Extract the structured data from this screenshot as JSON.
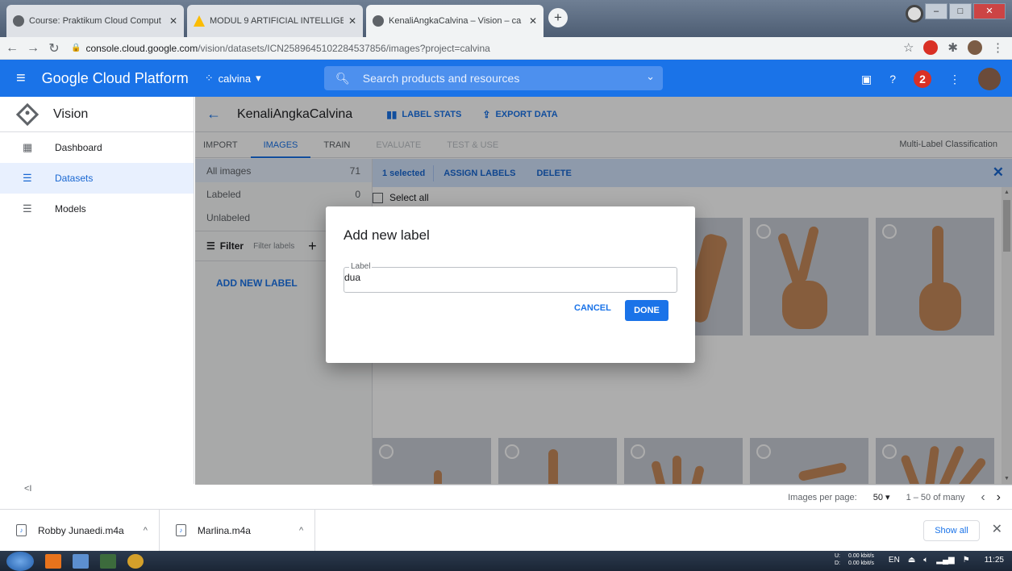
{
  "browser": {
    "tabs": [
      {
        "title": "Course: Praktikum Cloud Comput",
        "icon_color": "#5f6368"
      },
      {
        "title": "MODUL 9 ARTIFICIAL INTELLIGEN",
        "icon_color": "#fbbc04"
      },
      {
        "title": "KenaliAngkaCalvina – Vision – ca",
        "icon_color": "#5f6368"
      }
    ],
    "new_tab_label": "+",
    "url_domain": "console.cloud.google.com",
    "url_path": "/vision/datasets/ICN2589645102284537856/images?project=calvina",
    "extension_badge": "1"
  },
  "gcp": {
    "platform_title": "Google Cloud Platform",
    "project": "calvina",
    "search_placeholder": "Search products and resources",
    "notification_count": "2",
    "accent": "#1a73e8"
  },
  "sidebar": {
    "product": "Vision",
    "items": [
      {
        "label": "Dashboard",
        "icon": "dashboard-icon"
      },
      {
        "label": "Datasets",
        "icon": "list-icon"
      },
      {
        "label": "Models",
        "icon": "list-icon"
      }
    ],
    "collapse_label": "<I"
  },
  "main": {
    "dataset_name": "KenaliAngkaCalvina",
    "label_stats": "LABEL STATS",
    "export_data": "EXPORT DATA",
    "tabs": [
      "IMPORT",
      "IMAGES",
      "TRAIN",
      "EVALUATE",
      "TEST & USE"
    ],
    "classification_type": "Multi-Label Classification"
  },
  "filters": {
    "rows": [
      {
        "label": "All images",
        "count": "71"
      },
      {
        "label": "Labeled",
        "count": "0"
      },
      {
        "label": "Unlabeled",
        "count": ""
      }
    ],
    "filter_label": "Filter",
    "filter_placeholder": "Filter labels",
    "add_new_label": "ADD NEW LABEL"
  },
  "selection": {
    "selected": "1 selected",
    "assign": "ASSIGN LABELS",
    "delete": "DELETE",
    "select_all": "Select all"
  },
  "pager": {
    "images_per_page_label": "Images per page:",
    "per_page": "50",
    "range": "1 – 50 of many"
  },
  "dialog": {
    "title": "Add new label",
    "field_label": "Label",
    "field_value": "dua",
    "cancel": "CANCEL",
    "done": "DONE"
  },
  "downloads": {
    "files": [
      "Robby Junaedi.m4a",
      "Marlina.m4a"
    ],
    "show_all": "Show all"
  },
  "taskbar": {
    "net_up": "0.00 kbit/s",
    "net_down": "0.00 kbit/s",
    "up_label": "U:",
    "down_label": "D:",
    "lang": "EN",
    "time": "11:25"
  }
}
